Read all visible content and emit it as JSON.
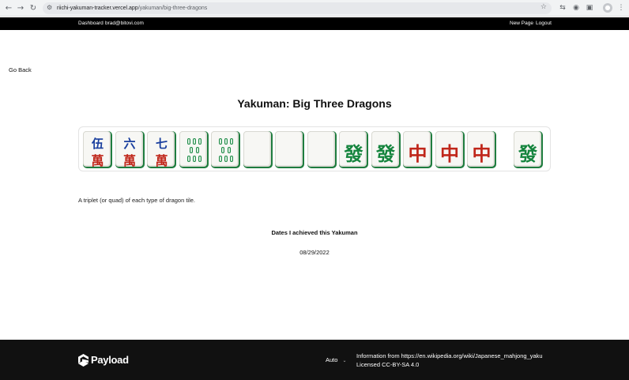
{
  "browser": {
    "url_host": "riichi-yakuman-tracker.vercel.app",
    "url_path": "/yakuman/big-three-dragons",
    "back_icon": "back-arrow-icon",
    "forward_icon": "forward-arrow-icon",
    "reload_icon": "reload-icon"
  },
  "nav": {
    "dashboard": "Dashboard",
    "user_email": "brad@bitovi.com",
    "new_page": "New Page",
    "logout": "Logout"
  },
  "page": {
    "go_back": "Go Back",
    "title": "Yakuman: Big Three Dragons",
    "description": "A triplet (or quad) of each type of dragon tile.",
    "dates_heading": "Dates I achieved this Yakuman",
    "dates": [
      "08/29/2022"
    ]
  },
  "tiles": [
    {
      "type": "character",
      "top": "伍",
      "bottom": "萬"
    },
    {
      "type": "character",
      "top": "六",
      "bottom": "萬"
    },
    {
      "type": "character",
      "top": "七",
      "bottom": "萬"
    },
    {
      "type": "bamboo",
      "count": 8
    },
    {
      "type": "bamboo",
      "count": 8
    },
    {
      "type": "white-dragon"
    },
    {
      "type": "white-dragon"
    },
    {
      "type": "white-dragon"
    },
    {
      "type": "green-dragon",
      "glyph": "發"
    },
    {
      "type": "green-dragon",
      "glyph": "發"
    },
    {
      "type": "red-dragon",
      "glyph": "中"
    },
    {
      "type": "red-dragon",
      "glyph": "中"
    },
    {
      "type": "red-dragon",
      "glyph": "中"
    },
    {
      "type": "green-dragon",
      "glyph": "發"
    }
  ],
  "colors": {
    "tile_back": "#1f7d3f",
    "character_top": "#1a3f9e",
    "character_bottom": "#c0271b",
    "green_dragon": "#14843d",
    "red_dragon": "#c0271b"
  },
  "footer": {
    "logo_text": "Payload",
    "theme": "Auto",
    "credit_line1": "Information from https://en.wikipedia.org/wiki/Japanese_mahjong_yaku",
    "credit_line2": "Licensed CC-BY-SA 4.0"
  }
}
